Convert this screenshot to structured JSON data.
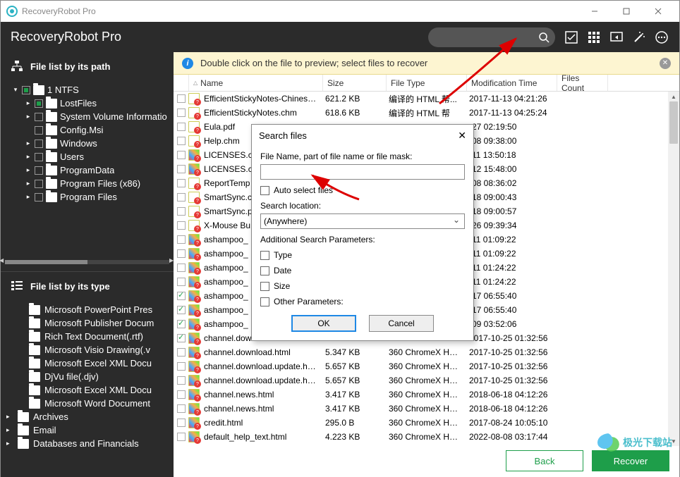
{
  "titlebar": {
    "title": "RecoveryRobot Pro"
  },
  "header": {
    "appName": "RecoveryRobot Pro"
  },
  "infoBar": {
    "text": "Double click on the file to preview; select files to recover"
  },
  "sidebar": {
    "pathHead": "File list by its path",
    "typeHead": "File list by its type",
    "tree": [
      {
        "level": 0,
        "caret": "▾",
        "chk": "partial",
        "label": "1 NTFS"
      },
      {
        "level": 1,
        "caret": "▸",
        "chk": "partial",
        "label": "LostFiles"
      },
      {
        "level": 1,
        "caret": "▸",
        "chk": "",
        "label": "System Volume Informatio"
      },
      {
        "level": 1,
        "caret": "",
        "chk": "",
        "label": "Config.Msi"
      },
      {
        "level": 1,
        "caret": "▸",
        "chk": "",
        "label": "Windows"
      },
      {
        "level": 1,
        "caret": "▸",
        "chk": "",
        "label": "Users"
      },
      {
        "level": 1,
        "caret": "▸",
        "chk": "",
        "label": "ProgramData"
      },
      {
        "level": 1,
        "caret": "▸",
        "chk": "",
        "label": "Program Files (x86)"
      },
      {
        "level": 1,
        "caret": "▸",
        "chk": "",
        "label": "Program Files"
      }
    ],
    "types": [
      {
        "caret": "",
        "label": "Microsoft PowerPoint Pres"
      },
      {
        "caret": "",
        "label": "Microsoft Publisher Docum"
      },
      {
        "caret": "",
        "label": "Rich Text Document(.rtf)"
      },
      {
        "caret": "",
        "label": "Microsoft Visio Drawing(.v"
      },
      {
        "caret": "",
        "label": "Microsoft Excel XML Docu"
      },
      {
        "caret": "",
        "label": "DjVu file(.djv)"
      },
      {
        "caret": "",
        "label": "Microsoft Excel XML Docu"
      },
      {
        "caret": "",
        "label": "Microsoft Word Document"
      },
      {
        "caret": "▸",
        "label": "Archives",
        "top": true
      },
      {
        "caret": "▸",
        "label": "Email",
        "top": true
      },
      {
        "caret": "▸",
        "label": "Databases and Financials",
        "top": true
      }
    ]
  },
  "columns": {
    "name": "Name",
    "size": "Size",
    "type": "File Type",
    "mod": "Modification Time",
    "cnt": "Files Count"
  },
  "rows": [
    {
      "chk": false,
      "ico": "doc",
      "name": "EfficientStickyNotes-Chinese_...",
      "size": "621.2 KB",
      "type": "编译的 HTML 帮...",
      "mod": "2017-11-13 04:21:26"
    },
    {
      "chk": false,
      "ico": "doc",
      "name": "EfficientStickyNotes.chm",
      "size": "618.6 KB",
      "type": "编译的 HTML 帮",
      "mod": "2017-11-13 04:25:24"
    },
    {
      "chk": false,
      "ico": "pdf",
      "name": "Eula.pdf",
      "size": "",
      "type": "",
      "mod": "-27 02:19:50"
    },
    {
      "chk": false,
      "ico": "doc",
      "name": "Help.chm",
      "size": "",
      "type": "",
      "mod": "-08 09:38:00"
    },
    {
      "chk": false,
      "ico": "col",
      "name": "LICENSES.ch",
      "size": "",
      "type": "",
      "mod": "-11 13:50:18"
    },
    {
      "chk": false,
      "ico": "col",
      "name": "LICENSES.ch",
      "size": "",
      "type": "",
      "mod": "-12 15:48:00"
    },
    {
      "chk": false,
      "ico": "doc",
      "name": "ReportTemp",
      "size": "",
      "type": "",
      "mod": "-08 08:36:02"
    },
    {
      "chk": false,
      "ico": "pdf",
      "name": "SmartSync.ch",
      "size": "",
      "type": "",
      "mod": "-18 09:00:43"
    },
    {
      "chk": false,
      "ico": "pdf",
      "name": "SmartSync.pd",
      "size": "",
      "type": "",
      "mod": "-18 09:00:57"
    },
    {
      "chk": false,
      "ico": "doc",
      "name": "X-Mouse Bu",
      "size": "",
      "type": "",
      "mod": "-26 09:39:34"
    },
    {
      "chk": false,
      "ico": "col",
      "name": "ashampoo_",
      "size": "",
      "type": "",
      "mod": "-11 01:09:22"
    },
    {
      "chk": false,
      "ico": "col",
      "name": "ashampoo_",
      "size": "",
      "type": "",
      "mod": "-11 01:09:22"
    },
    {
      "chk": false,
      "ico": "col",
      "name": "ashampoo_",
      "size": "",
      "type": "",
      "mod": "-11 01:24:22"
    },
    {
      "chk": false,
      "ico": "col",
      "name": "ashampoo_",
      "size": "",
      "type": "",
      "mod": "-11 01:24:22"
    },
    {
      "chk": true,
      "ico": "col",
      "name": "ashampoo_",
      "size": "",
      "type": "",
      "mod": "-17 06:55:40"
    },
    {
      "chk": true,
      "ico": "col",
      "name": "ashampoo_",
      "size": "",
      "type": "",
      "mod": "-17 06:55:40"
    },
    {
      "chk": true,
      "ico": "col",
      "name": "ashampoo_",
      "size": "",
      "type": "",
      "mod": "-09 03:52:06"
    },
    {
      "chk": true,
      "ico": "col",
      "name": "channel.download.html",
      "size": "5.347 KB",
      "type": "360 ChromeX HTM...",
      "mod": "2017-10-25 01:32:56"
    },
    {
      "chk": false,
      "ico": "col",
      "name": "channel.download.html",
      "size": "5.347 KB",
      "type": "360 ChromeX HTM...",
      "mod": "2017-10-25 01:32:56"
    },
    {
      "chk": false,
      "ico": "col",
      "name": "channel.download.update.html",
      "size": "5.657 KB",
      "type": "360 ChromeX HTM...",
      "mod": "2017-10-25 01:32:56"
    },
    {
      "chk": false,
      "ico": "col",
      "name": "channel.download.update.html",
      "size": "5.657 KB",
      "type": "360 ChromeX HTM...",
      "mod": "2017-10-25 01:32:56"
    },
    {
      "chk": false,
      "ico": "col",
      "name": "channel.news.html",
      "size": "3.417 KB",
      "type": "360 ChromeX HTM...",
      "mod": "2018-06-18 04:12:26"
    },
    {
      "chk": false,
      "ico": "col",
      "name": "channel.news.html",
      "size": "3.417 KB",
      "type": "360 ChromeX HTM...",
      "mod": "2018-06-18 04:12:26"
    },
    {
      "chk": false,
      "ico": "col",
      "name": "credit.html",
      "size": "295.0 B",
      "type": "360 ChromeX HTM...",
      "mod": "2017-08-24 10:05:10"
    },
    {
      "chk": false,
      "ico": "col",
      "name": "default_help_text.html",
      "size": "4.223 KB",
      "type": "360 ChromeX HTM",
      "mod": "2022-08-08 03:17:44"
    }
  ],
  "dialog": {
    "title": "Search files",
    "fileNameLabel": "File Name, part of file name or file mask:",
    "autoSelect": "Auto select files",
    "searchLocLabel": "Search location:",
    "searchLocValue": "(Anywhere)",
    "addParams": "Additional Search Parameters:",
    "pType": "Type",
    "pDate": "Date",
    "pSize": "Size",
    "pOther": "Other Parameters:",
    "ok": "OK",
    "cancel": "Cancel"
  },
  "footer": {
    "back": "Back",
    "recover": "Recover"
  },
  "watermark": "极光下载站"
}
